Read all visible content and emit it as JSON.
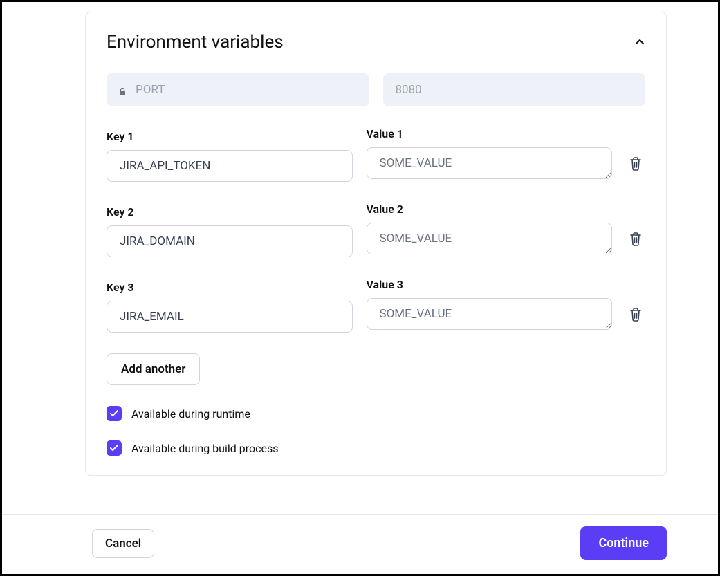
{
  "card": {
    "title": "Environment variables"
  },
  "locked": {
    "key": "PORT",
    "value": "8080"
  },
  "vars": [
    {
      "key_label": "Key 1",
      "key": "JIRA_API_TOKEN",
      "value_label": "Value 1",
      "value_placeholder": "SOME_VALUE"
    },
    {
      "key_label": "Key 2",
      "key": "JIRA_DOMAIN",
      "value_label": "Value 2",
      "value_placeholder": "SOME_VALUE"
    },
    {
      "key_label": "Key 3",
      "key": "JIRA_EMAIL",
      "value_label": "Value 3",
      "value_placeholder": "SOME_VALUE"
    }
  ],
  "buttons": {
    "add_another": "Add another",
    "cancel": "Cancel",
    "continue": "Continue"
  },
  "checkboxes": {
    "runtime": "Available during runtime",
    "build": "Available during build process"
  }
}
